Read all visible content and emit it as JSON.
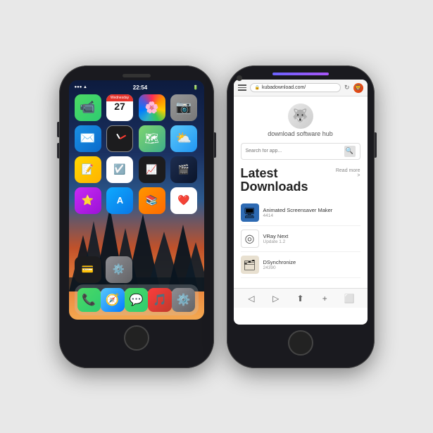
{
  "left_phone": {
    "status": {
      "time": "22:54",
      "signal": "●●●",
      "wifi": "▲",
      "battery": "■"
    },
    "icons": [
      {
        "name": "FaceTime",
        "type": "facetime",
        "emoji": "📹"
      },
      {
        "name": "Calendar",
        "type": "calendar",
        "day": "27",
        "month": "Wednesday"
      },
      {
        "name": "Photos",
        "type": "photos",
        "emoji": "🌸"
      },
      {
        "name": "Camera",
        "type": "camera",
        "emoji": "📷"
      },
      {
        "name": "Mail",
        "type": "mail",
        "emoji": "✉️"
      },
      {
        "name": "Clock",
        "type": "clock"
      },
      {
        "name": "Maps",
        "type": "maps",
        "emoji": "🗺"
      },
      {
        "name": "Weather",
        "type": "weather",
        "emoji": "⛅"
      },
      {
        "name": "Notes",
        "type": "notes",
        "emoji": "📝"
      },
      {
        "name": "Reminders",
        "type": "reminders",
        "emoji": "☑️"
      },
      {
        "name": "Stocks",
        "type": "stocks",
        "emoji": "📈"
      },
      {
        "name": "iMovie",
        "type": "imovie",
        "emoji": "🎬"
      },
      {
        "name": "Starred",
        "type": "starred",
        "emoji": "⭐"
      },
      {
        "name": "App Store",
        "type": "appstore",
        "emoji": "A"
      },
      {
        "name": "Books",
        "type": "books",
        "emoji": "📚"
      },
      {
        "name": "Health",
        "type": "health",
        "emoji": "❤️"
      },
      {
        "name": "Wallet",
        "type": "wallet",
        "emoji": "💳"
      },
      {
        "name": "Settings",
        "type": "settings-ios",
        "emoji": "⚙️"
      }
    ],
    "dock": [
      {
        "name": "Phone",
        "type": "phone-app",
        "emoji": "📞"
      },
      {
        "name": "Safari",
        "type": "safari",
        "emoji": "🧭"
      },
      {
        "name": "Messages",
        "type": "messages",
        "emoji": "💬"
      },
      {
        "name": "Music",
        "type": "music",
        "emoji": "🎵"
      },
      {
        "name": "Settings",
        "type": "settings-dock",
        "emoji": "⚙️"
      }
    ]
  },
  "right_phone": {
    "url": "kubadownload.com/",
    "site_title": "download software hub",
    "search_placeholder": "Search for app...",
    "section_title": "Latest\nDownloads",
    "read_more": "Read more\n>",
    "downloads": [
      {
        "name": "Animated Screensaver Maker",
        "sub": "4414",
        "emoji": "🖥"
      },
      {
        "name": "VRay Next",
        "sub": "Update 1.2",
        "emoji": "◎"
      },
      {
        "name": "DSynchronize",
        "sub": "24390",
        "emoji": "🗂"
      }
    ],
    "bottom_nav": [
      "◁",
      "▷",
      "⬆",
      "+",
      "⬜"
    ]
  }
}
